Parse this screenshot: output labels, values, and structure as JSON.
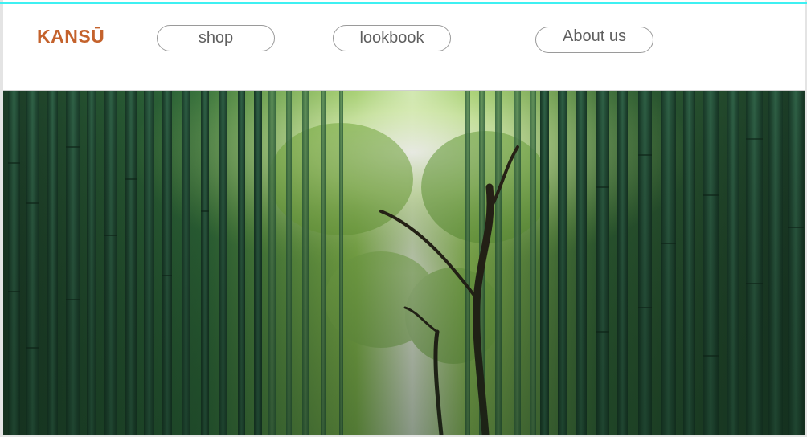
{
  "brand": {
    "logo": "KANSŪ",
    "accent": "#c4622c"
  },
  "nav": {
    "items": [
      {
        "label": "shop"
      },
      {
        "label": "lookbook"
      },
      {
        "label": "About us"
      }
    ]
  },
  "hero": {
    "scene": "bamboo-grove-photo"
  }
}
